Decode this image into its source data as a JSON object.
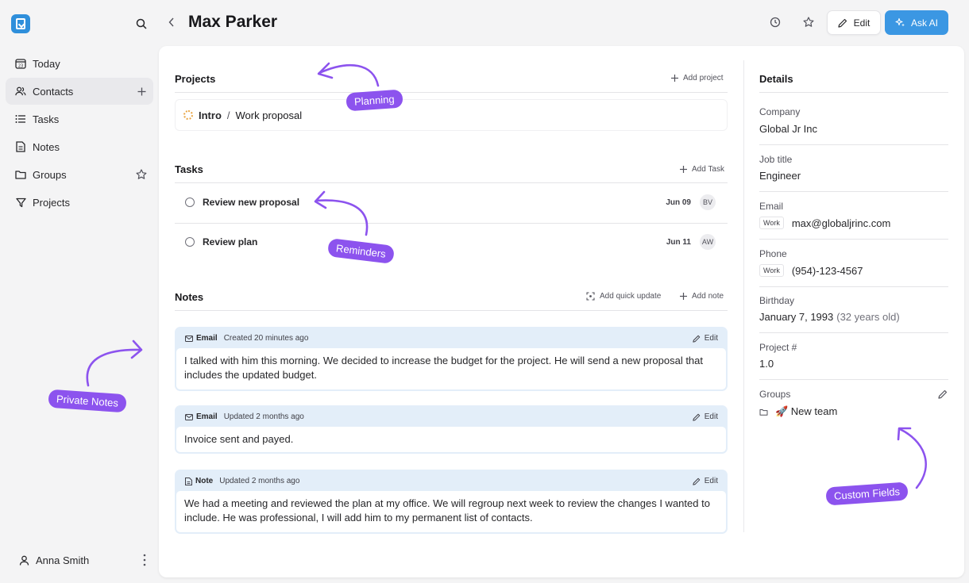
{
  "sidebar": {
    "logo_icon": "app-logo-icon",
    "items": [
      {
        "label": "Today",
        "icon": "calendar-icon"
      },
      {
        "label": "Contacts",
        "icon": "users-icon"
      },
      {
        "label": "Tasks",
        "icon": "list-icon"
      },
      {
        "label": "Notes",
        "icon": "document-icon"
      },
      {
        "label": "Groups",
        "icon": "folder-icon"
      },
      {
        "label": "Projects",
        "icon": "filter-icon"
      }
    ],
    "user_name": "Anna Smith"
  },
  "header": {
    "title": "Max Parker",
    "edit_label": "Edit",
    "ask_ai_label": "Ask AI"
  },
  "projects": {
    "title": "Projects",
    "add_label": "Add project",
    "item": {
      "parent": "Intro",
      "name": "Work proposal"
    }
  },
  "tasks": {
    "title": "Tasks",
    "add_label": "Add Task",
    "items": [
      {
        "label": "Review new proposal",
        "date": "Jun 09",
        "assignee": "BV"
      },
      {
        "label": "Review plan",
        "date": "Jun 11",
        "assignee": "AW"
      }
    ]
  },
  "notes": {
    "title": "Notes",
    "quick_update_label": "Add quick update",
    "add_label": "Add note",
    "items": [
      {
        "kind": "Email",
        "meta": "Created 20 minutes ago",
        "edit": "Edit",
        "body": "I talked with him this morning. We decided to increase the budget for the project. He will send a new proposal that includes the updated budget."
      },
      {
        "kind": "Email",
        "meta": "Updated 2 months ago",
        "edit": "Edit",
        "body": "Invoice sent and payed."
      },
      {
        "kind": "Note",
        "meta": "Updated 2 months ago",
        "edit": "Edit",
        "body": "We had a meeting and reviewed the plan at my office. We will regroup next week to review the changes I wanted to include. He was professional, I will add him to my permanent list of contacts."
      }
    ]
  },
  "details": {
    "title": "Details",
    "company_label": "Company",
    "company": "Global Jr Inc",
    "job_label": "Job title",
    "job": "Engineer",
    "email_label": "Email",
    "email_tag": "Work",
    "email": "max@globaljrinc.com",
    "phone_label": "Phone",
    "phone_tag": "Work",
    "phone": "(954)-123-4567",
    "birthday_label": "Birthday",
    "birthday": "January 7, 1993",
    "age": "(32 years old)",
    "project_label": "Project #",
    "project": "1.0",
    "groups_label": "Groups",
    "group": "🚀 New team"
  },
  "annotations": {
    "planning": "Planning",
    "reminders": "Reminders",
    "private_notes": "Private Notes",
    "custom_fields": "Custom Fields",
    "color": "#8c53ee"
  },
  "colors": {
    "accent": "#3b97e3",
    "note_bg": "#e3eef9",
    "annotation": "#8c53ee"
  }
}
